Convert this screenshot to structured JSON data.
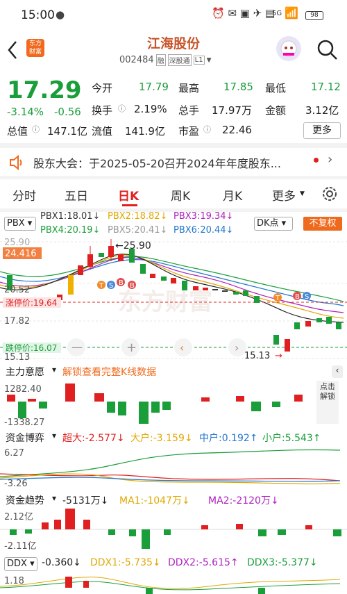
{
  "status": {
    "time": "15:00",
    "net": "5G",
    "battery": "98"
  },
  "header": {
    "title": "江海股份",
    "code": "002484",
    "badges": [
      "融",
      "深股通",
      "L1"
    ],
    "logo_line1": "东方",
    "logo_line2": "财富"
  },
  "quote": {
    "price": "17.29",
    "change_pct": "-3.14%",
    "change": "-0.56",
    "open_label": "今开",
    "open": "17.79",
    "high_label": "最高",
    "high": "17.85",
    "low_label": "最低",
    "low": "17.12",
    "turnover_label": "换手",
    "turnover": "2.19%",
    "vol_label": "总手",
    "vol": "17.97万",
    "amount_label": "金额",
    "amount": "3.12亿",
    "mcap_label": "总值",
    "mcap": "147.1亿",
    "float_label": "流值",
    "float": "141.9亿",
    "pe_label": "市盈",
    "pe": "22.46",
    "more": "更多"
  },
  "notice": {
    "text": "股东大会：于2025-05-20召开2024年年度股东..."
  },
  "tabs": [
    "分时",
    "五日",
    "日K",
    "周K",
    "月K",
    "更多"
  ],
  "active_tab": "日K",
  "indicator": {
    "name": "PBX",
    "dk": "DK点",
    "fq": "不复权",
    "pbx1": "PBX1:18.01↓",
    "pbx2": "PBX2:18.82↓",
    "pbx3": "PBX3:19.34↓",
    "pbx4": "PBX4:20.19↓",
    "pbx5": "PBX5:20.41↓",
    "pbx6": "PBX6:20.44↓"
  },
  "kline": {
    "y_top": "25.90",
    "y_mid1": "24.416",
    "y_mid2": "20.52",
    "y_mid3": "17.82",
    "y_bot": "15.13",
    "max_label": "25.90",
    "min_label": "15.13",
    "limit_up": "涨停价:19.64",
    "limit_down": "跌停价:16.07",
    "watermark": "东方财富"
  },
  "zl": {
    "title": "主力意愿",
    "lock": "解锁查看完整K线数据",
    "top": "1282.40",
    "bot": "-1338.27",
    "side": "点击解锁"
  },
  "zj": {
    "title": "资金博弈",
    "super": "超大:-2.577↓",
    "big": "大户:-3.159↓",
    "mid": "中户:0.192↑",
    "small": "小户:5.543↑",
    "top": "6.27",
    "bot": "-3.26"
  },
  "trend": {
    "title": "资金趋势",
    "val": "-5131万↓",
    "ma1": "MA1:-1047万↓",
    "ma2": "MA2:-2120万↓",
    "top": "2.12亿",
    "bot": "-2.11亿"
  },
  "ddx": {
    "title": "DDX",
    "val": "-0.360↓",
    "d1": "DDX1:-5.735↓",
    "d2": "DDX2:-5.615↑",
    "d3": "DDX3:-5.377↓",
    "top": "1.18"
  },
  "colors": {
    "up": "#e02020",
    "down": "#1a9e3a",
    "accent": "#f06a1e"
  }
}
